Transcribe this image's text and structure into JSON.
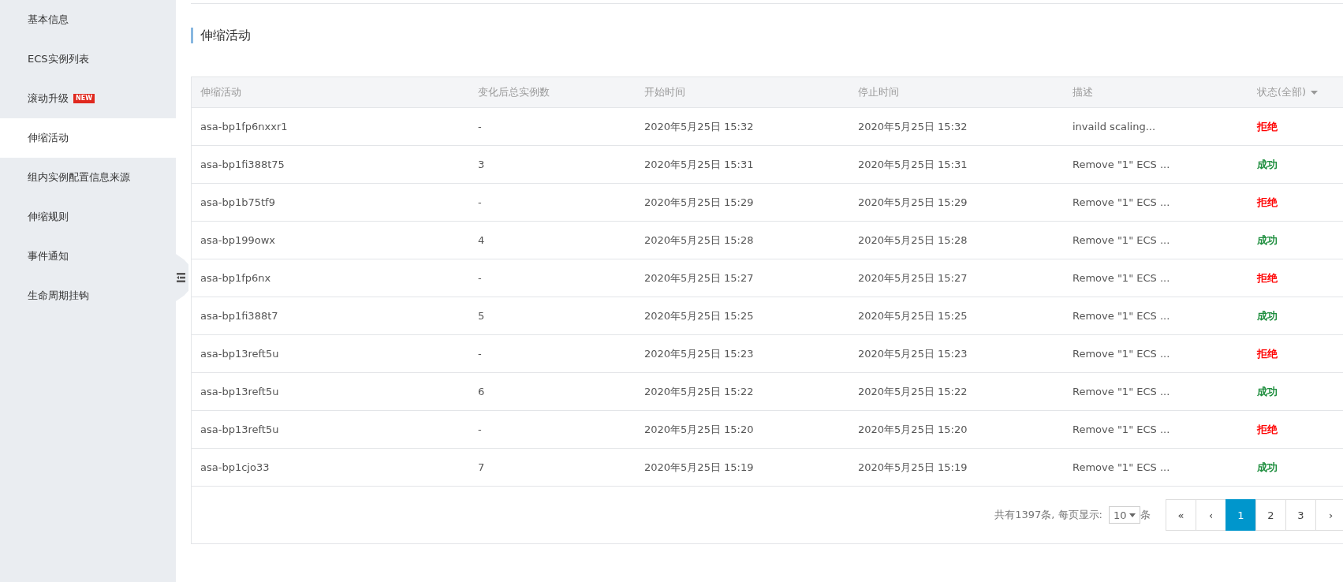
{
  "sidebar": {
    "items": [
      {
        "label": "基本信息",
        "selected": false
      },
      {
        "label": "ECS实例列表",
        "selected": false
      },
      {
        "label": "滚动升级",
        "selected": false,
        "badge": "NEW"
      },
      {
        "label": "伸缩活动",
        "selected": true
      },
      {
        "label": "组内实例配置信息来源",
        "selected": false
      },
      {
        "label": "伸缩规则",
        "selected": false
      },
      {
        "label": "事件通知",
        "selected": false
      },
      {
        "label": "生命周期挂钩",
        "selected": false
      }
    ]
  },
  "section_title": "伸缩活动",
  "table": {
    "columns": [
      "伸缩活动",
      "变化后总实例数",
      "开始时间",
      "停止时间",
      "描述",
      "状态(全部)"
    ],
    "rows": [
      {
        "activity": "asa-bp1fp6nxxr1",
        "count": "-",
        "start": "2020年5月25日 15:32",
        "stop": "2020年5月25日 15:32",
        "description": "invaild scaling...",
        "status": "拒绝",
        "color": "#ff0000"
      },
      {
        "activity": "asa-bp1fi388t75",
        "count": "3",
        "start": "2020年5月25日 15:31",
        "stop": "2020年5月25日 15:31",
        "description": "Remove \"1\" ECS ...",
        "status": "成功",
        "color": "#1e8e3e"
      },
      {
        "activity": "asa-bp1b75tf9",
        "count": "-",
        "start": "2020年5月25日 15:29",
        "stop": "2020年5月25日 15:29",
        "description": "Remove \"1\" ECS ...",
        "status": "拒绝",
        "color": "#ff0000"
      },
      {
        "activity": "asa-bp199owx",
        "count": "4",
        "start": "2020年5月25日 15:28",
        "stop": "2020年5月25日 15:28",
        "description": "Remove \"1\" ECS ...",
        "status": "成功",
        "color": "#1e8e3e"
      },
      {
        "activity": "asa-bp1fp6nx",
        "count": "-",
        "start": "2020年5月25日 15:27",
        "stop": "2020年5月25日 15:27",
        "description": "Remove \"1\" ECS ...",
        "status": "拒绝",
        "color": "#ff0000"
      },
      {
        "activity": "asa-bp1fi388t7",
        "count": "5",
        "start": "2020年5月25日 15:25",
        "stop": "2020年5月25日 15:25",
        "description": "Remove \"1\" ECS ...",
        "status": "成功",
        "color": "#1e8e3e"
      },
      {
        "activity": "asa-bp13reft5u",
        "count": "-",
        "start": "2020年5月25日 15:23",
        "stop": "2020年5月25日 15:23",
        "description": "Remove \"1\" ECS ...",
        "status": "拒绝",
        "color": "#ff0000"
      },
      {
        "activity": "asa-bp13reft5u",
        "count": "6",
        "start": "2020年5月25日 15:22",
        "stop": "2020年5月25日 15:22",
        "description": "Remove \"1\" ECS ...",
        "status": "成功",
        "color": "#1e8e3e"
      },
      {
        "activity": "asa-bp13reft5u",
        "count": "-",
        "start": "2020年5月25日 15:20",
        "stop": "2020年5月25日 15:20",
        "description": "Remove \"1\" ECS ...",
        "status": "拒绝",
        "color": "#ff0000"
      },
      {
        "activity": "asa-bp1cjo33",
        "count": "7",
        "start": "2020年5月25日 15:19",
        "stop": "2020年5月25日 15:19",
        "description": "Remove \"1\" ECS ...",
        "status": "成功",
        "color": "#1e8e3e"
      }
    ]
  },
  "footer": {
    "total": "共有1397条, 每页显示:",
    "page_size": "10",
    "unit": "条",
    "pages": [
      {
        "label": "«",
        "selected": false
      },
      {
        "label": "‹",
        "selected": false
      },
      {
        "label": "1",
        "selected": true
      },
      {
        "label": "2",
        "selected": false
      },
      {
        "label": "3",
        "selected": false
      },
      {
        "label": "›",
        "selected": false
      }
    ]
  }
}
